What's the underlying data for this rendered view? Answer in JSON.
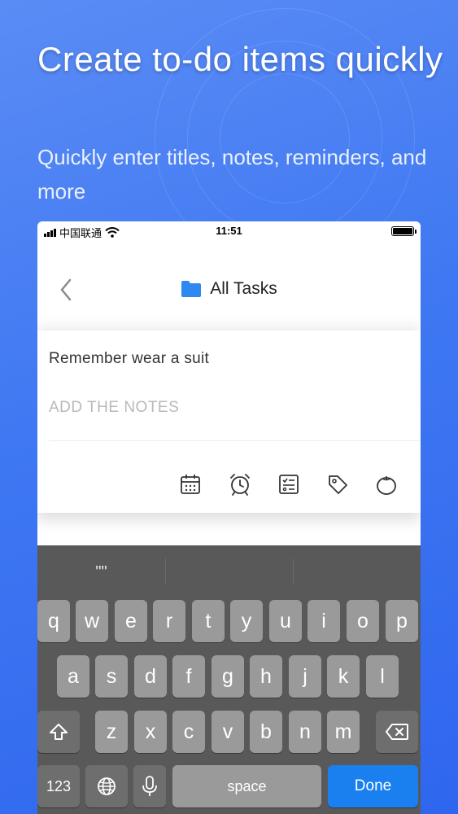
{
  "headline": "Create to-do items quickly",
  "subline": "Quickly enter titles, notes, reminders, and more",
  "status_bar": {
    "carrier": "中国联通",
    "time": "11:51"
  },
  "nav": {
    "title": "All Tasks",
    "folder_color": "#2f88f0"
  },
  "task": {
    "title": "Remember wear a suit",
    "notes_placeholder": "ADD THE NOTES"
  },
  "toolbar": {
    "icons": [
      "calendar-icon",
      "alarm-clock-icon",
      "checklist-icon",
      "tag-icon",
      "pomodoro-icon"
    ]
  },
  "keyboard": {
    "suggestions": [
      "\"\"",
      "",
      ""
    ],
    "row1": [
      "q",
      "w",
      "e",
      "r",
      "t",
      "y",
      "u",
      "i",
      "o",
      "p"
    ],
    "row2": [
      "a",
      "s",
      "d",
      "f",
      "g",
      "h",
      "j",
      "k",
      "l"
    ],
    "row3": [
      "z",
      "x",
      "c",
      "v",
      "b",
      "n",
      "m"
    ],
    "numbers_key": "123",
    "space_key": "space",
    "done_key": "Done",
    "done_color": "#1a80f0"
  }
}
